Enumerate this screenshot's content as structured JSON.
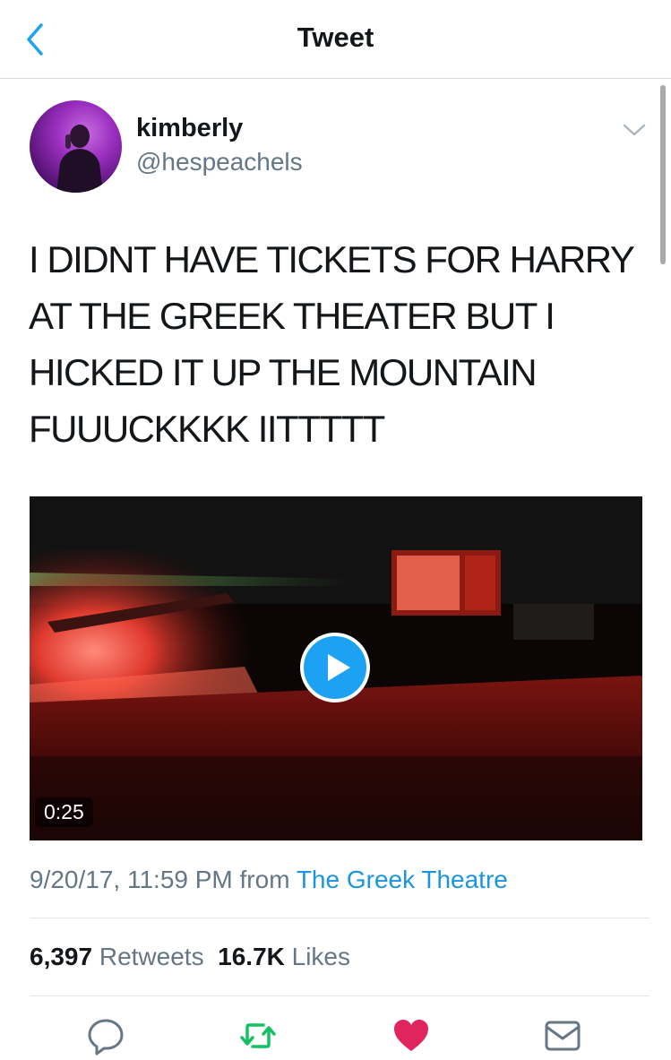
{
  "header": {
    "title": "Tweet",
    "back_icon": "chevron-left-icon"
  },
  "author": {
    "display_name": "kimberly",
    "handle": "@hespeachels",
    "menu_icon": "chevron-down-icon"
  },
  "tweet": {
    "text": "I DIDNT HAVE TICKETS FOR HARRY\nAT THE GREEK THEATER BUT I\nHICKED IT UP THE MOUNTAIN\nFUUUCKKKK IITTTTT"
  },
  "video": {
    "duration": "0:25",
    "play_icon": "play-icon"
  },
  "meta": {
    "timestamp": "9/20/17, 11:59 PM",
    "from_word": "from",
    "source": "The Greek Theatre"
  },
  "stats": {
    "retweets_count": "6,397",
    "retweets_label": "Retweets",
    "likes_count": "16.7K",
    "likes_label": "Likes"
  },
  "actions": [
    {
      "name": "reply",
      "icon": "reply-icon"
    },
    {
      "name": "retweet",
      "icon": "retweet-icon"
    },
    {
      "name": "like",
      "icon": "heart-icon"
    },
    {
      "name": "dm",
      "icon": "mail-icon"
    }
  ],
  "colors": {
    "accent_blue": "#1da1f2",
    "link_blue": "#1b95e0",
    "retweet_green": "#17bf63",
    "like_red": "#e0245e",
    "secondary_gray": "#657786"
  }
}
